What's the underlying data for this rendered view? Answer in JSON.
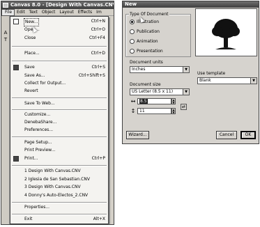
{
  "app": {
    "title": "Canvas 8.0 - [Design With Canvas.CNV",
    "menubar": [
      "File",
      "Edit",
      "Text",
      "Object",
      "Layout",
      "Effects",
      "Im"
    ],
    "tools": [
      "A",
      "T"
    ]
  },
  "file_menu": {
    "items": [
      {
        "label": "New...",
        "shortcut": "Ctrl+N"
      },
      {
        "label": "Open...",
        "shortcut": "Ctrl+O"
      },
      {
        "label": "Close",
        "shortcut": "Ctrl+F4"
      },
      {
        "label": "Place...",
        "shortcut": "Ctrl+D"
      },
      {
        "label": "Save",
        "shortcut": "Ctrl+S"
      },
      {
        "label": "Save As...",
        "shortcut": "Ctrl+Shift+S"
      },
      {
        "label": "Collect for Output...",
        "shortcut": ""
      },
      {
        "label": "Revert",
        "shortcut": ""
      },
      {
        "label": "Save To Web...",
        "shortcut": ""
      },
      {
        "label": "Customize...",
        "shortcut": ""
      },
      {
        "label": "DenebaShare...",
        "shortcut": ""
      },
      {
        "label": "Preferences...",
        "shortcut": ""
      },
      {
        "label": "Page Setup...",
        "shortcut": ""
      },
      {
        "label": "Print Preview...",
        "shortcut": ""
      },
      {
        "label": "Print...",
        "shortcut": "Ctrl+P"
      },
      {
        "label": "1 Design With Canvas.CNV",
        "shortcut": ""
      },
      {
        "label": "2 Iglesia de San Sebastian.CNV",
        "shortcut": ""
      },
      {
        "label": "3 Design With Canvas.CNV",
        "shortcut": ""
      },
      {
        "label": "4 Donny's Auto-Electos_2.CNV",
        "shortcut": ""
      },
      {
        "label": "Properties...",
        "shortcut": ""
      },
      {
        "label": "Exit",
        "shortcut": "Alt+X"
      }
    ]
  },
  "dialog": {
    "title": "New",
    "type_group": {
      "caption": "Type Of Document",
      "options": [
        "Illustration",
        "Publication",
        "Animation",
        "Presentation"
      ],
      "selected": "Illustration"
    },
    "units": {
      "caption": "Document units",
      "value": "Inches"
    },
    "size": {
      "caption": "Document size",
      "value": "US Letter (8.5 x 11)",
      "width": "8.5",
      "height": "11"
    },
    "template": {
      "caption": "Use template",
      "value": "Blank"
    },
    "buttons": {
      "wizard": "Wizard...",
      "cancel": "Cancel",
      "ok": "OK"
    }
  }
}
